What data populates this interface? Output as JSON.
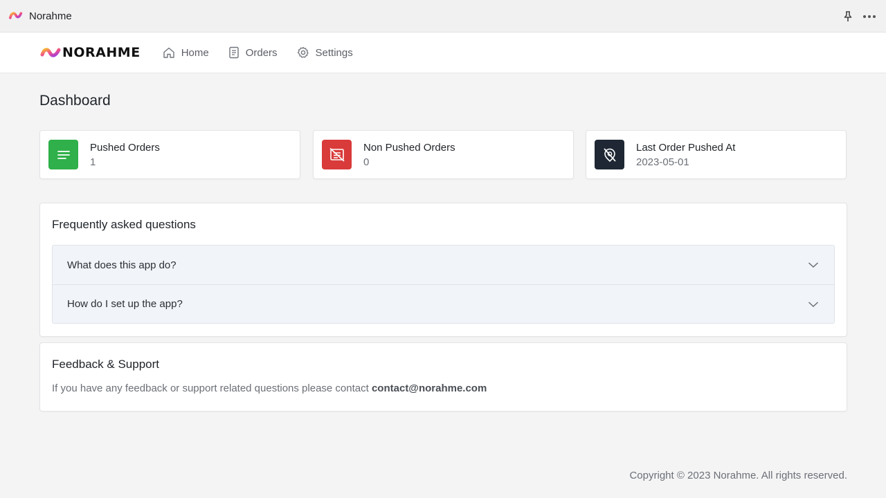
{
  "window": {
    "app_name": "Norahme",
    "actions": [
      {
        "name": "pin",
        "icon": "pin-icon"
      },
      {
        "name": "more",
        "icon": "more-horizontal-icon"
      }
    ]
  },
  "navbar": {
    "brand_text": "NORAHME",
    "items": [
      {
        "label": "Home",
        "icon": "home-icon"
      },
      {
        "label": "Orders",
        "icon": "document-icon"
      },
      {
        "label": "Settings",
        "icon": "gear-icon"
      }
    ]
  },
  "page": {
    "title": "Dashboard"
  },
  "stats": [
    {
      "label": "Pushed Orders",
      "value": "1",
      "icon": "list-icon",
      "color": "#2fb04a"
    },
    {
      "label": "Non Pushed Orders",
      "value": "0",
      "icon": "list-off-icon",
      "color": "#d93a3a"
    },
    {
      "label": "Last Order Pushed At",
      "value": "2023-05-01",
      "icon": "location-off-icon",
      "color": "#1e2733"
    }
  ],
  "faq": {
    "title": "Frequently asked questions",
    "items": [
      {
        "question": "What does this app do?"
      },
      {
        "question": "How do I set up the app?"
      }
    ]
  },
  "support": {
    "title": "Feedback & Support",
    "text": "If you have any feedback or support related questions please contact ",
    "email": "contact@norahme.com"
  },
  "footer": {
    "copyright": "Copyright © 2023 Norahme. All rights reserved."
  }
}
